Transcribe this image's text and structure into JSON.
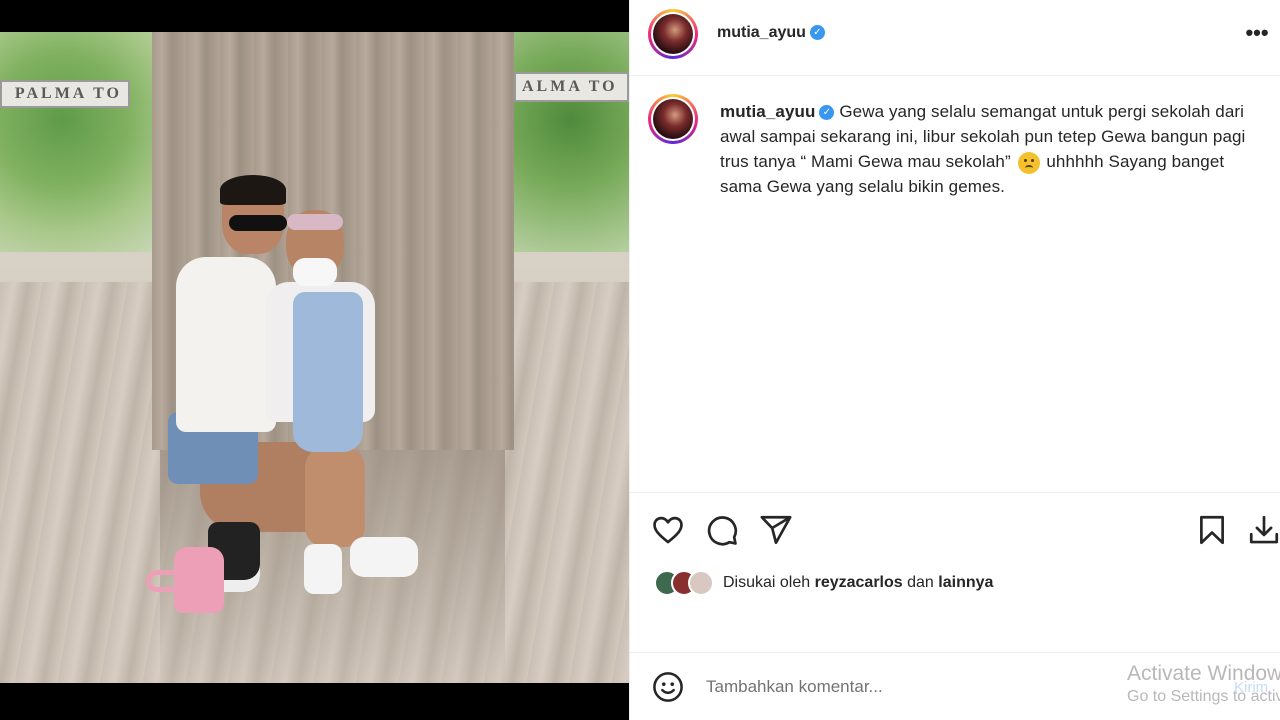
{
  "photo": {
    "sign_left": "PALMA TO",
    "sign_right": "ALMA TO"
  },
  "post": {
    "username": "mutia_ayuu",
    "verified_mark": "✓",
    "more_label": "•••",
    "caption_username": "mutia_ayuu",
    "caption_part1": "Gewa yang selalu semangat untuk pergi sekolah dari awal sampai sekarang ini, libur sekolah pun tetep Gewa bangun pagi trus tanya “ Mami Gewa mau sekolah”",
    "caption_part2": "uhhhhh Sayang banget sama Gewa yang selalu bikin gemes."
  },
  "actions": {
    "like_icon": "heart-icon",
    "comment_icon": "comment-icon",
    "share_icon": "send-icon",
    "save_icon": "bookmark-icon",
    "download_icon": "download-icon"
  },
  "likes": {
    "prefix": "Disukai oleh",
    "user": "reyzacarlos",
    "conjunction": "dan",
    "others": "lainnya",
    "avatar_colors": [
      "#3d6a4e",
      "#8a2f2f",
      "#d9c7c2"
    ]
  },
  "comment": {
    "placeholder": "Tambahkan komentar...",
    "submit_label": "Kirim"
  },
  "watermark": {
    "line1": "Activate Windows",
    "line2": "Go to Settings to activate Windows."
  },
  "colors": {
    "verified": "#3897f0",
    "text": "#262626",
    "muted": "#737373"
  }
}
